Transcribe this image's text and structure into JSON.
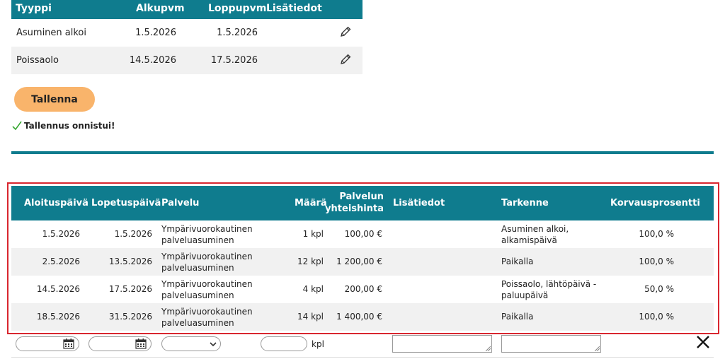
{
  "top_table": {
    "headers": [
      "Tyyppi",
      "Alkupvm",
      "Loppupvm",
      "Lisätiedot"
    ],
    "rows": [
      {
        "type": "Asuminen alkoi",
        "start": "1.5.2026",
        "end": "1.5.2026",
        "info": ""
      },
      {
        "type": "Poissaolo",
        "start": "14.5.2026",
        "end": "17.5.2026",
        "info": ""
      }
    ]
  },
  "save_button": "Tallenna",
  "success_message": "Tallennus onnistui!",
  "services_table": {
    "headers": {
      "start": "Aloituspäivä",
      "end": "Lopetuspäivä",
      "service": "Palvelu",
      "amount": "Määrä",
      "total_line1": "Palvelun",
      "total_line2": "yhteishinta",
      "info": "Lisätiedot",
      "detail": "Tarkenne",
      "percent": "Korvausprosentti"
    },
    "rows": [
      {
        "start": "1.5.2026",
        "end": "1.5.2026",
        "service1": "Ympärivuorokautinen",
        "service2": "palveluasuminen",
        "amount": "1 kpl",
        "total": "100,00 €",
        "info": "",
        "detail1": "Asuminen alkoi,",
        "detail2": "alkamispäivä",
        "percent": "100,0 %"
      },
      {
        "start": "2.5.2026",
        "end": "13.5.2026",
        "service1": "Ympärivuorokautinen",
        "service2": "palveluasuminen",
        "amount": "12 kpl",
        "total": "1 200,00 €",
        "info": "",
        "detail1": "Paikalla",
        "detail2": "",
        "percent": "100,0 %"
      },
      {
        "start": "14.5.2026",
        "end": "17.5.2026",
        "service1": "Ympärivuorokautinen",
        "service2": "palveluasuminen",
        "amount": "4 kpl",
        "total": "200,00 €",
        "info": "",
        "detail1": "Poissaolo, lähtöpäivä -",
        "detail2": "paluupäivä",
        "percent": "50,0 %"
      },
      {
        "start": "18.5.2026",
        "end": "31.5.2026",
        "service1": "Ympärivuorokautinen",
        "service2": "palveluasuminen",
        "amount": "14 kpl",
        "total": "1 400,00 €",
        "info": "",
        "detail1": "Paikalla",
        "detail2": "",
        "percent": "100,0 %"
      }
    ]
  },
  "new_row": {
    "unit_label": "kpl",
    "start_value": "",
    "end_value": "",
    "service_value": "",
    "amount_value": ""
  },
  "colors": {
    "header": "#0f7c8e",
    "accent_button": "#f9b46b",
    "highlight_border": "#d9262f",
    "success_check": "#3aa935"
  }
}
